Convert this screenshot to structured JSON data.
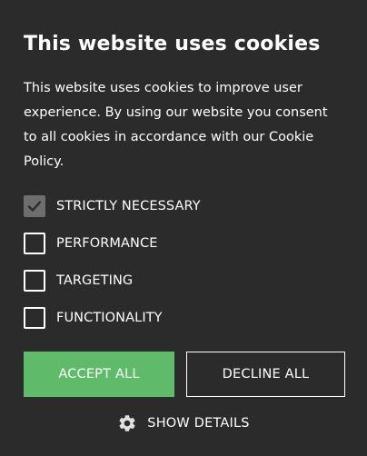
{
  "banner": {
    "title": "This website uses cookies",
    "description": "This website uses cookies to improve user experience. By using our website you consent to all cookies in accordance with our Cookie Policy."
  },
  "options": [
    {
      "label": "STRICTLY NECESSARY",
      "checked": true,
      "disabled": true
    },
    {
      "label": "PERFORMANCE",
      "checked": false,
      "disabled": false
    },
    {
      "label": "TARGETING",
      "checked": false,
      "disabled": false
    },
    {
      "label": "FUNCTIONALITY",
      "checked": false,
      "disabled": false
    }
  ],
  "buttons": {
    "accept_label": "ACCEPT ALL",
    "decline_label": "DECLINE ALL"
  },
  "details": {
    "label": "SHOW DETAILS",
    "icon": "gear-icon"
  },
  "colors": {
    "background": "#2b2b2b",
    "accent": "#5fbb6a",
    "text": "#ffffff",
    "disabled_checkbox": "#6e6e6e"
  }
}
